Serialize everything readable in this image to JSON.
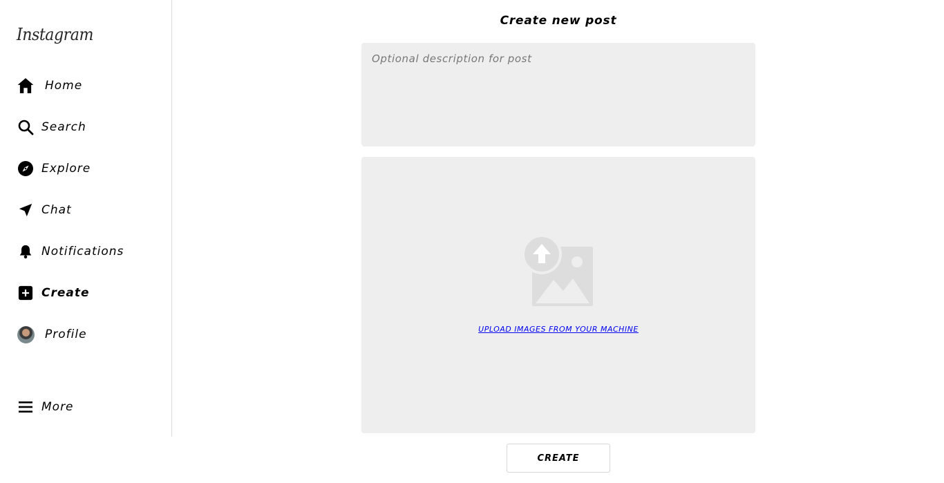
{
  "app": {
    "logo": "Instagram"
  },
  "sidebar": {
    "items": [
      {
        "label": "Home",
        "icon": "home-icon"
      },
      {
        "label": "Search",
        "icon": "search-icon"
      },
      {
        "label": "Explore",
        "icon": "compass-icon"
      },
      {
        "label": "Chat",
        "icon": "send-icon"
      },
      {
        "label": "Notifications",
        "icon": "bell-icon"
      },
      {
        "label": "Create",
        "icon": "plus-square-icon",
        "active": true
      },
      {
        "label": "Profile",
        "icon": "avatar"
      }
    ],
    "more": {
      "label": "More",
      "icon": "menu-icon"
    }
  },
  "main": {
    "title": "Create new post",
    "description": {
      "value": "",
      "placeholder": "Optional description for post"
    },
    "upload": {
      "icon": "image-upload-icon",
      "link_label": "UPLOAD IMAGES FROM YOUR MACHINE"
    },
    "create_button": "CREATE"
  },
  "colors": {
    "panel_bg": "#eeeeee",
    "link": "#0000ee",
    "icon_gray": "#dddddd",
    "border": "#dbdbdb"
  }
}
